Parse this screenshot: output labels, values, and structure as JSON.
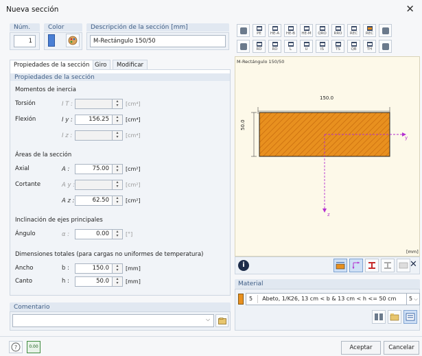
{
  "window": {
    "title": "Nueva sección"
  },
  "header": {
    "num_label": "Núm.",
    "num_value": "1",
    "color_label": "Color",
    "color_swatch": "#4a7fd4",
    "desc_label": "Descripción de la sección [mm]",
    "desc_value": "M-Rectángulo 150/50"
  },
  "tabs": [
    {
      "label": "Propiedades de la sección"
    },
    {
      "label": "Giro"
    },
    {
      "label": "Modificar"
    }
  ],
  "props": {
    "section_title": "Propiedades de la sección",
    "inertia_header": "Momentos de inercia",
    "torsion_label": "Torsión",
    "torsion_sym": "I T :",
    "torsion_value": "",
    "torsion_unit": "[cm⁴]",
    "flexion_label": "Flexión",
    "flexion_sym_y": "I y :",
    "flexion_value_y": "156.25",
    "flexion_unit_y": "[cm⁴]",
    "flexion_sym_z": "I z :",
    "flexion_value_z": "",
    "flexion_unit_z": "[cm⁴]",
    "areas_header": "Áreas de la sección",
    "axial_label": "Axial",
    "axial_sym": "A :",
    "axial_value": "75.00",
    "axial_unit": "[cm²]",
    "shear_label": "Cortante",
    "shear_sym_y": "A y :",
    "shear_value_y": "",
    "shear_unit_y": "[cm²]",
    "shear_sym_z": "A z :",
    "shear_value_z": "62.50",
    "shear_unit_z": "[cm²]",
    "incl_header": "Inclinación de ejes principales",
    "angle_label": "Ángulo",
    "angle_sym": "α :",
    "angle_value": "0.00",
    "angle_unit": "[°]",
    "dims_header": "Dimensiones totales (para cargas no uniformes de temperatura)",
    "width_label": "Ancho",
    "width_sym": "b :",
    "width_value": "150.0",
    "width_unit": "[mm]",
    "height_label": "Canto",
    "height_sym": "h :",
    "height_value": "50.0",
    "height_unit": "[mm]"
  },
  "comment": {
    "label": "Comentario",
    "value": ""
  },
  "preview": {
    "caption": "M-Rectángulo 150/50",
    "dim_width": "150.0",
    "dim_height": "50.0",
    "axis_y": "y",
    "axis_z": "z",
    "unit": "[mm]",
    "fill_color": "#e8901f"
  },
  "toolbar_row1": [
    "",
    "PE",
    "HE-A",
    "HE-B",
    "HE-M",
    "QRO",
    "RRO",
    "REC",
    "REC",
    ""
  ],
  "toolbar_row2": [
    "",
    "RD",
    "RD",
    "L",
    "U",
    "IS",
    "TS",
    "QB",
    "TH",
    ""
  ],
  "material": {
    "label": "Material",
    "index": "5",
    "value": "Abeto, 1/K26, 13 cm < b & 13 cm < h <= 50 cm",
    "dropdown": "5",
    "swatch": "#e8901f"
  },
  "footer": {
    "ok_label": "Aceptar",
    "cancel_label": "Cancelar",
    "units_icon_text": "0.00"
  }
}
